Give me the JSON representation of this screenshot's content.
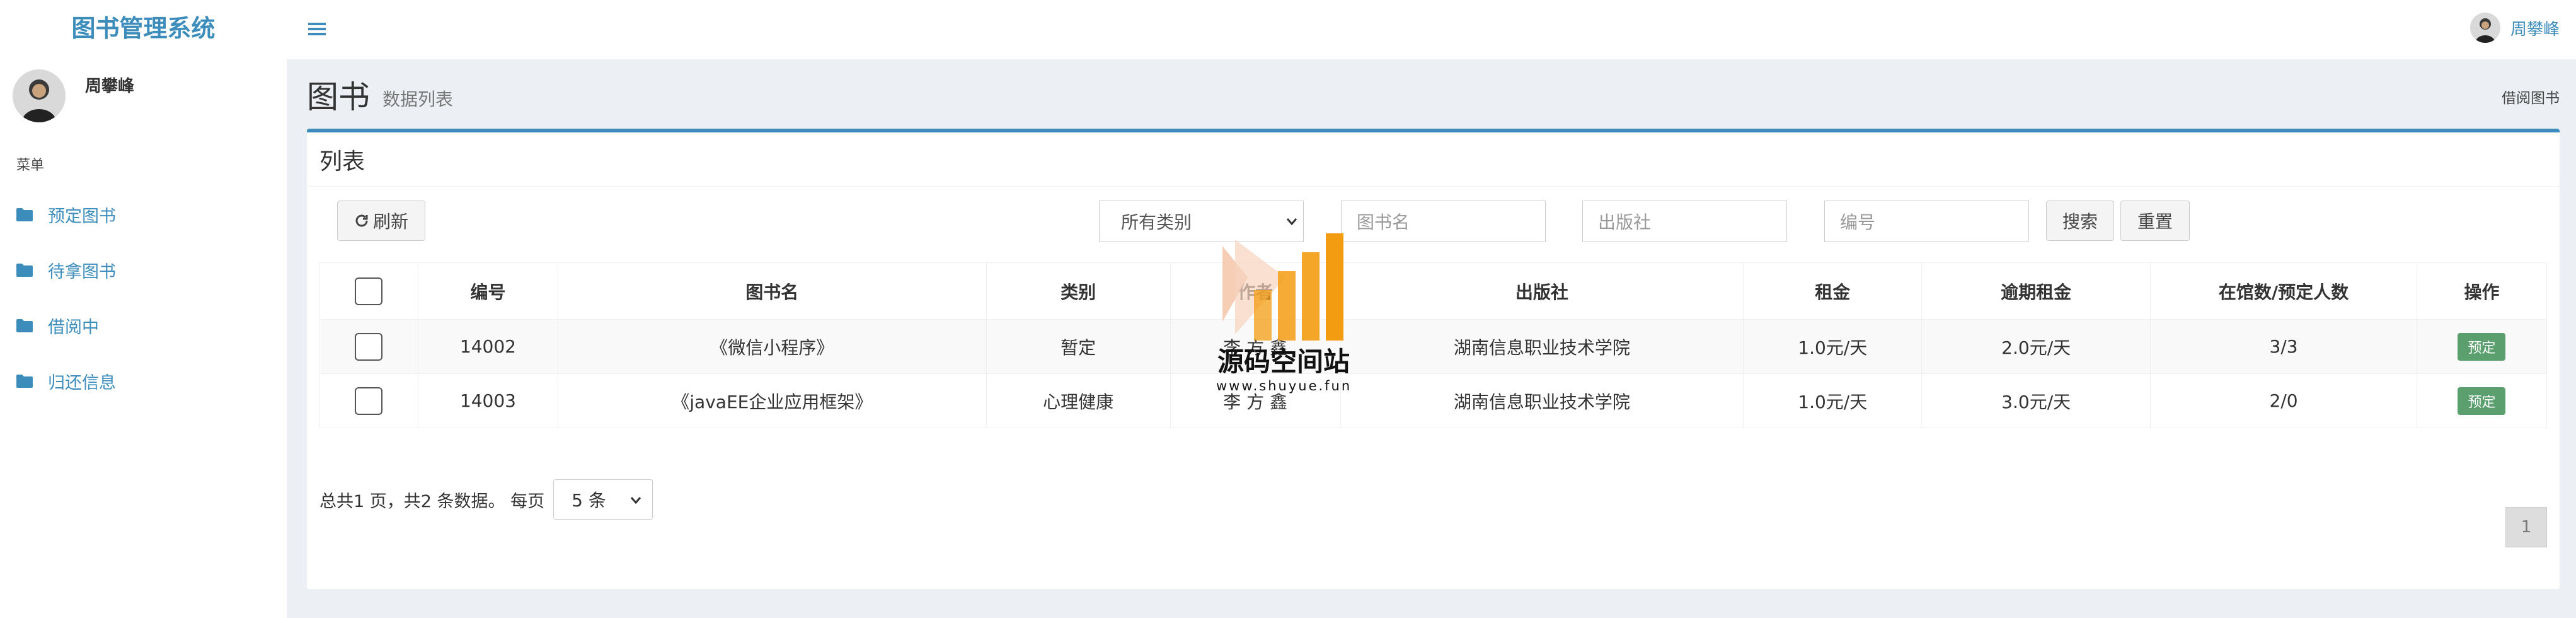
{
  "app": {
    "title": "图书管理系统"
  },
  "user": {
    "name": "周攀峰"
  },
  "sidebar": {
    "menu_header": "菜单",
    "items": [
      {
        "label": "预定图书"
      },
      {
        "label": "待拿图书"
      },
      {
        "label": "借阅中"
      },
      {
        "label": "归还信息"
      }
    ]
  },
  "page": {
    "title": "图书",
    "subtitle": "数据列表",
    "breadcrumb": "借阅图书"
  },
  "box": {
    "title": "列表"
  },
  "toolbar": {
    "refresh_label": "刷新",
    "category_selected": "所有类别",
    "search_name_placeholder": "图书名",
    "search_publisher_placeholder": "出版社",
    "search_number_placeholder": "编号",
    "search_label": "搜索",
    "reset_label": "重置"
  },
  "table": {
    "headers": [
      "编号",
      "图书名",
      "类别",
      "作者",
      "出版社",
      "租金",
      "逾期租金",
      "在馆数/预定人数",
      "操作"
    ],
    "rows": [
      {
        "number": "14002",
        "name": "《微信小程序》",
        "category": "暂定",
        "author": "李 方 鑫",
        "publisher": "湖南信息职业技术学院",
        "rent": "1.0元/天",
        "overdue_rent": "2.0元/天",
        "stock": "3/3",
        "action": "预定"
      },
      {
        "number": "14003",
        "name": "《javaEE企业应用框架》",
        "category": "心理健康",
        "author": "李 方 鑫",
        "publisher": "湖南信息职业技术学院",
        "rent": "1.0元/天",
        "overdue_rent": "3.0元/天",
        "stock": "2/0",
        "action": "预定"
      }
    ]
  },
  "pagination": {
    "summary": "总共1 页，共2 条数据。 每页",
    "page_size": "5 条",
    "current_page": "1"
  },
  "watermark": {
    "text": "源码空间站",
    "url": "www.shuyue.fun"
  },
  "colors": {
    "brand": "#3c8dbc",
    "success": "#5b9f6f",
    "watermark_orange": "#f39c12"
  }
}
